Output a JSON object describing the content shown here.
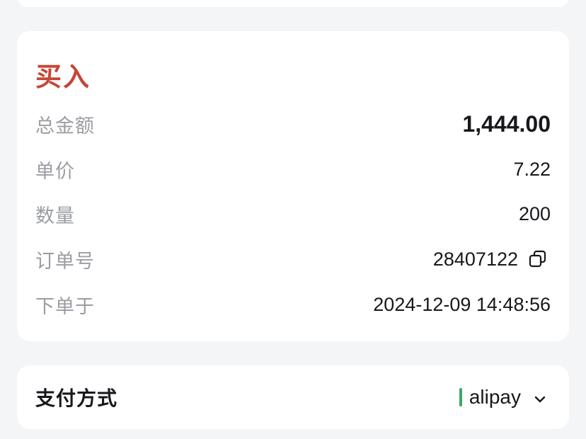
{
  "order": {
    "side_label": "买入",
    "side_color": "#c74535",
    "rows": [
      {
        "label": "总金额",
        "value": "1,444.00"
      },
      {
        "label": "单价",
        "value": "7.22"
      },
      {
        "label": "数量",
        "value": "200"
      },
      {
        "label": "订单号",
        "value": "28407122"
      },
      {
        "label": "下单于",
        "value": "2024-12-09 14:48:56"
      }
    ]
  },
  "payment": {
    "label": "支付方式",
    "method": "alipay",
    "accent_color": "#3fa66b",
    "icons": [
      "chevron-down-icon"
    ]
  },
  "icons": [
    "copy-icon"
  ]
}
